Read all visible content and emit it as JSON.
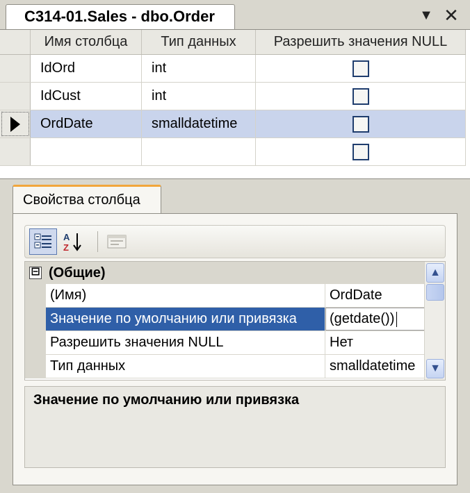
{
  "document_tab": {
    "title": "C314-01.Sales - dbo.Order"
  },
  "window_controls": {
    "dropdown_icon": "triangle-down-icon",
    "close_icon": "close-icon",
    "dropdown_glyph": "▼",
    "close_glyph": "✕"
  },
  "columns_grid": {
    "headers": [
      "Имя столбца",
      "Тип данных",
      "Разрешить значения NULL"
    ],
    "rows": [
      {
        "name": "IdOrd",
        "type": "int",
        "allow_null": false,
        "selected": false
      },
      {
        "name": "IdCust",
        "type": "int",
        "allow_null": false,
        "selected": false
      },
      {
        "name": "OrdDate",
        "type": "smalldatetime",
        "allow_null": false,
        "selected": true
      },
      {
        "name": "",
        "type": "",
        "allow_null": false,
        "selected": false
      }
    ]
  },
  "properties": {
    "tab_label": "Свойства столбца",
    "toolbar": {
      "categorized_icon": "categorized-view-icon",
      "alphabetical_icon": "sort-alphabetical-icon",
      "property_pages_icon": "property-pages-icon"
    },
    "category": {
      "toggle": "⊟",
      "label": "(Общие)"
    },
    "rows": [
      {
        "name": "(Имя)",
        "value": "OrdDate",
        "selected": false
      },
      {
        "name": "Значение по умолчанию или привязка",
        "value": "(getdate())",
        "selected": true
      },
      {
        "name": "Разрешить значения NULL",
        "value": "Нет",
        "selected": false
      },
      {
        "name": "Тип данных",
        "value": "smalldatetime",
        "selected": false
      }
    ],
    "description": "Значение по умолчанию или привязка"
  },
  "colors": {
    "selection_row": "#c9d4ec",
    "selection_property": "#2f5fa8",
    "tab_accent": "#f2a63b"
  }
}
